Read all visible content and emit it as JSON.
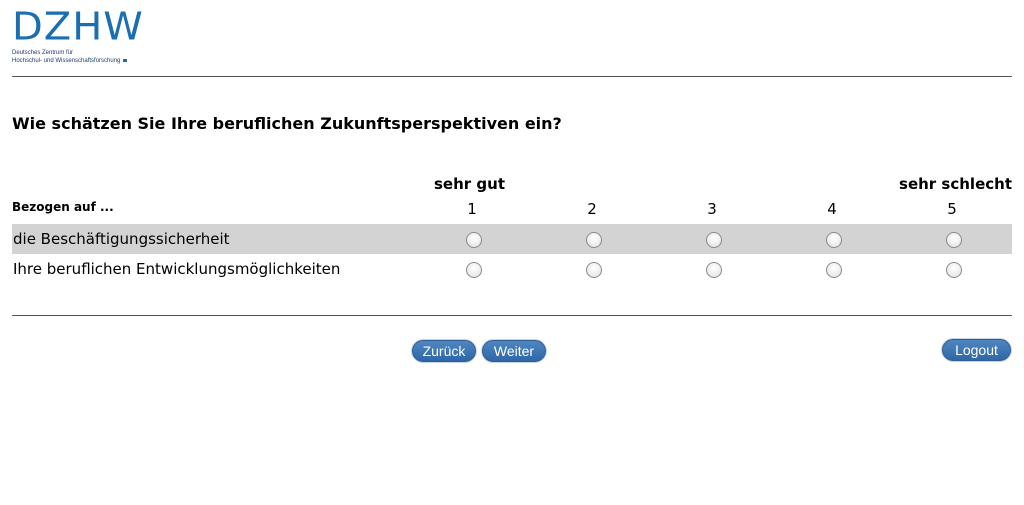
{
  "logo": {
    "mark": "DZHW",
    "subtitle_line1": "Deutsches Zentrum für",
    "subtitle_line2": "Hochschul- und Wissenschaftsforschung",
    "brand_color": "#1b6fb0"
  },
  "question": "Wie schätzen Sie Ihre beruflichen Zukunftsperspektiven ein?",
  "scale": {
    "left_label": "sehr gut",
    "right_label": "sehr schlecht",
    "reference_label": "Bezogen auf ...",
    "columns": [
      "1",
      "2",
      "3",
      "4",
      "5"
    ]
  },
  "rows": [
    {
      "label": "die Beschäftigungssicherheit",
      "selected": null
    },
    {
      "label": "Ihre beruflichen Entwicklungsmöglichkeiten",
      "selected": null
    }
  ],
  "buttons": {
    "back": "Zurück",
    "next": "Weiter",
    "logout": "Logout"
  },
  "colors": {
    "button": "#3a70b0",
    "row_shade": "#d3d3d3"
  }
}
